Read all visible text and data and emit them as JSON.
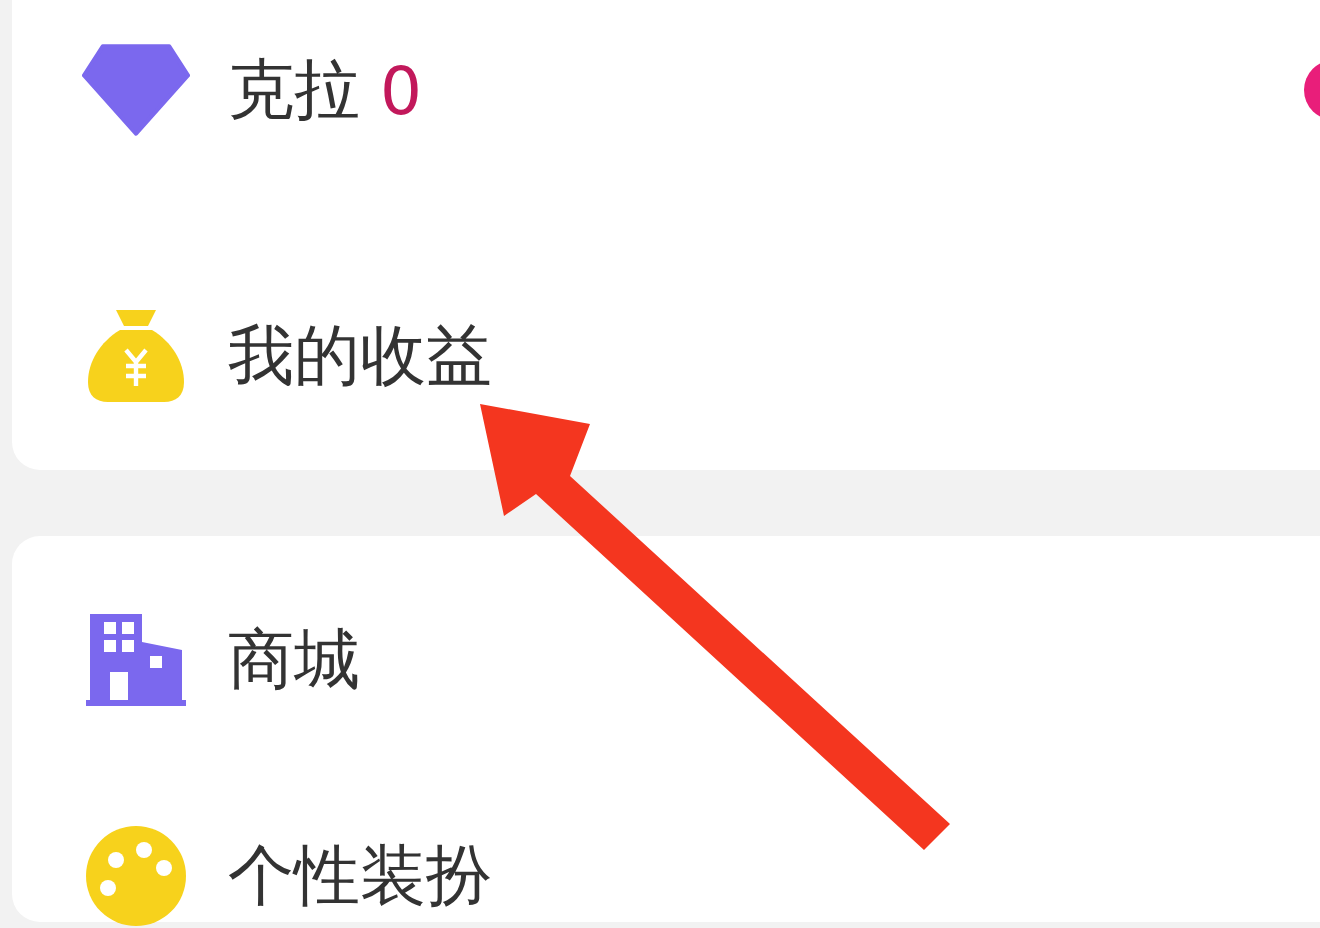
{
  "cards": [
    {
      "rows": [
        {
          "kind": "carat",
          "label": "克拉",
          "value": "0"
        },
        {
          "kind": "earnings",
          "label": "我的收益"
        }
      ]
    },
    {
      "rows": [
        {
          "kind": "shop",
          "label": "商城"
        },
        {
          "kind": "dressup",
          "label": "个性装扮"
        }
      ]
    }
  ]
}
